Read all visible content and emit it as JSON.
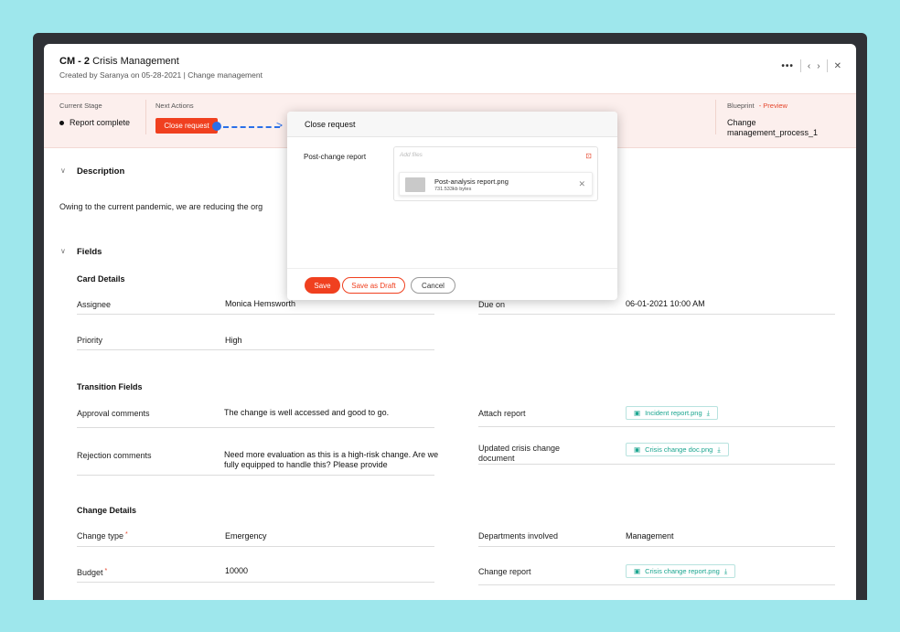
{
  "header": {
    "id": "CM - 2",
    "title": "Crisis Management",
    "subtitle": "Created by Saranya  on 05-28-2021 | Change management",
    "more_label": "•••",
    "prev_label": "‹",
    "next_label": "›",
    "close_label": "✕"
  },
  "stage_bar": {
    "current_stage_label": "Current Stage",
    "current_stage_value": "Report complete",
    "next_actions_label": "Next Actions",
    "next_action_button": "Close request",
    "blueprint_label": "Blueprint",
    "blueprint_preview": "- Preview",
    "blueprint_value": "Change management_process_1"
  },
  "description": {
    "toggle": "∨",
    "title": "Description",
    "text": "Owing to the current pandemic, we are reducing the org"
  },
  "fields": {
    "toggle": "∨",
    "title": "Fields",
    "card_details": {
      "title": "Card Details",
      "assignee_label": "Assignee",
      "assignee_value": "Monica Hemsworth",
      "due_label": "Due on",
      "due_value": "06-01-2021 10:00 AM",
      "priority_label": "Priority",
      "priority_value": "High"
    },
    "transition_fields": {
      "title": "Transition Fields",
      "approval_label": "Approval comments",
      "approval_value": "The change is well accessed and good to go.",
      "attach_label": "Attach report",
      "attach_file": "Incident report.png",
      "rejection_label": "Rejection comments",
      "rejection_value": "Need more evaluation as this is a high-risk change. Are we fully equipped to handle this? Please provide",
      "updated_label": "Updated crisis change document",
      "updated_file": "Crisis change doc.png"
    },
    "change_details": {
      "title": "Change Details",
      "type_label": "Change type",
      "type_value": "Emergency",
      "departments_label": "Departments involved",
      "departments_value": "Management",
      "budget_label": "Budget",
      "budget_value": "10000",
      "report_label": "Change report",
      "report_file": "Crisis change report.png",
      "required_mark": "*"
    }
  },
  "modal": {
    "title": "Close request",
    "field_label": "Post-change report",
    "placeholder": "Add files",
    "file_name": "Post-analysis report.png",
    "file_size": "731.533kb bytes",
    "remove_label": "✕",
    "save_label": "Save",
    "draft_label": "Save as Draft",
    "cancel_label": "Cancel"
  },
  "colors": {
    "accent": "#f0401f",
    "background": "#9ee7ec",
    "stage_bar": "#fcefed",
    "link_teal": "#1aa58f",
    "flow_blue": "#2b6fe8"
  }
}
